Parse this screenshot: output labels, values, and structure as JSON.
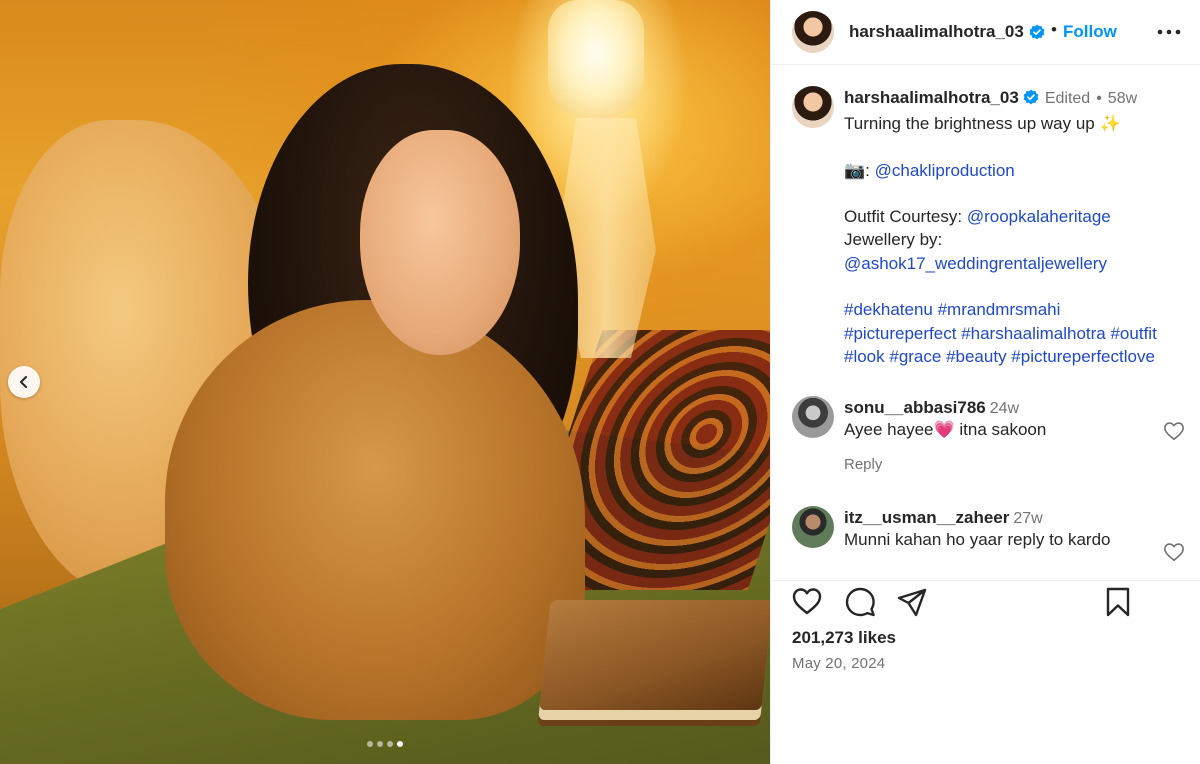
{
  "post": {
    "username": "harshaalimalhotra_03",
    "follow_label": "Follow",
    "separator": "•",
    "likes": "201,273 likes",
    "date": "May 20, 2024",
    "carousel": {
      "slides": 4,
      "active_index": 3
    }
  },
  "caption": {
    "username": "harshaalimalhotra_03",
    "edited": "Edited",
    "dot": "•",
    "age": "58w",
    "line_title": "Turning the brightness up way up ✨",
    "camera_prefix": "📷: ",
    "camera_handle": "@chakliproduction",
    "outfit_prefix": "Outfit Courtesy: ",
    "outfit_handle": "@roopkalaheritage",
    "jewellery_prefix": "Jewellery by:",
    "jewellery_handle": "@ashok17_weddingrentaljewellery",
    "hashtags_line1": "#dekhatenu #mrandmrsmahi",
    "hashtags_line2": "#pictureperfect #harshaalimalhotra #outfit",
    "hashtags_line3": "#look #grace #beauty #pictureperfectlove"
  },
  "comments": [
    {
      "username": "sonu__abbasi786",
      "age": "24w",
      "text": "Ayee hayee💗 itna sakoon",
      "reply": "Reply"
    },
    {
      "username": "itz__usman__zaheer",
      "age": "27w",
      "text": "Munni kahan ho yaar reply to kardo"
    }
  ],
  "colors": {
    "link": "#1f49c9",
    "follow": "#0095f6",
    "verified": "#0095f6",
    "muted": "#737373",
    "text": "#262626"
  },
  "icons": {
    "prev": "chevron-left-icon",
    "verified": "verified-badge-icon",
    "more": "more-horizontal-icon",
    "like": "heart-icon",
    "comment": "comment-icon",
    "share": "send-icon",
    "save": "bookmark-icon"
  }
}
